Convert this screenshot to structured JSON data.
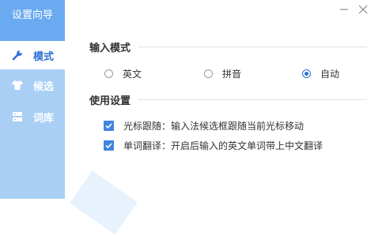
{
  "sidebar": {
    "title": "设置向导",
    "items": [
      {
        "label": "模式",
        "icon": "wrench-icon",
        "active": true
      },
      {
        "label": "候选",
        "icon": "shirt-icon",
        "active": false
      },
      {
        "label": "词库",
        "icon": "database-icon",
        "active": false
      }
    ]
  },
  "window": {
    "minimize_icon": "minimize-icon",
    "close_icon": "close-icon"
  },
  "input_mode": {
    "title": "输入模式",
    "options": [
      {
        "label": "英文",
        "selected": false
      },
      {
        "label": "拼音",
        "selected": false
      },
      {
        "label": "自动",
        "selected": true
      }
    ]
  },
  "usage": {
    "title": "使用设置",
    "options": [
      {
        "label": "光标跟随：输入法候选框跟随当前光标移动",
        "checked": true
      },
      {
        "label": "单词翻译：开启后输入的英文单词带上中文翻译",
        "checked": true
      }
    ]
  },
  "colors": {
    "sidebar": "#a9cff5",
    "sidebar_title": "#6aaaf0",
    "accent": "#2d6fd6",
    "checkbox": "#3f85e0"
  }
}
